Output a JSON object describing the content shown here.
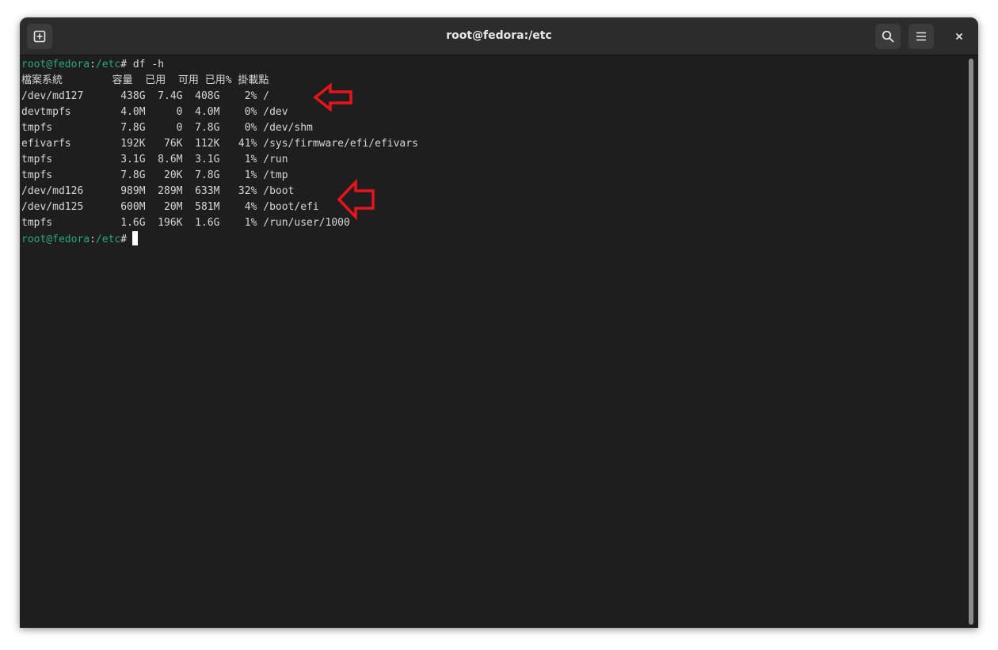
{
  "window": {
    "title": "root@fedora:/etc"
  },
  "titlebar": {
    "new_tab_icon": "new-tab-icon",
    "search_icon": "search-icon",
    "menu_icon": "hamburger-menu-icon",
    "close_icon": "close-icon"
  },
  "terminal": {
    "prompt_user_host": "root@fedora",
    "prompt_sep": ":",
    "prompt_path": "/etc",
    "prompt_symbol": "#",
    "command": " df -h",
    "header": "檔案系統        容量  已用  可用 已用% 掛載點",
    "rows": [
      "/dev/md127      438G  7.4G  408G    2% /",
      "devtmpfs        4.0M     0  4.0M    0% /dev",
      "tmpfs           7.8G     0  7.8G    0% /dev/shm",
      "efivarfs        192K   76K  112K   41% /sys/firmware/efi/efivars",
      "tmpfs           3.1G  8.6M  3.1G    1% /run",
      "tmpfs           7.8G   20K  7.8G    1% /tmp",
      "/dev/md126      989M  289M  633M   32% /boot",
      "/dev/md125      600M   20M  581M    4% /boot/efi",
      "tmpfs           1.6G  196K  1.6G    1% /run/user/1000"
    ]
  },
  "colors": {
    "prompt_green": "#2aa876",
    "terminal_bg": "#1e1e1e",
    "titlebar_bg": "#2c2c2c",
    "text": "#d6d6d6",
    "annotation_red": "#e8141c"
  }
}
